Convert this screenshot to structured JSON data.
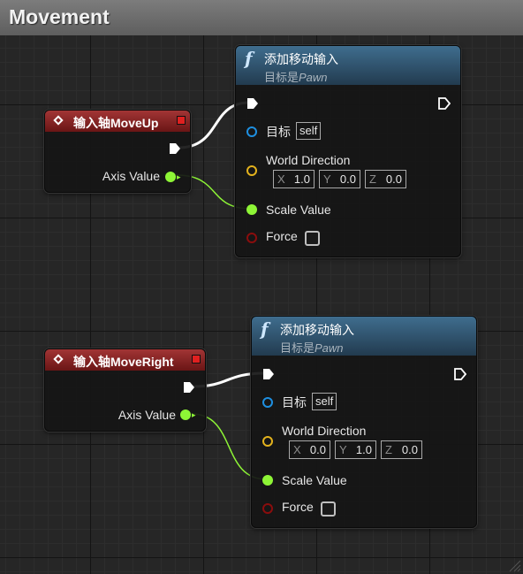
{
  "graph": {
    "title": "Movement"
  },
  "nodes": [
    {
      "event_title": "输入轴MoveUp",
      "axis_value_label": "Axis Value",
      "function": {
        "title": "添加移动输入",
        "subtitle_prefix": "目标是",
        "subtitle_class": "Pawn",
        "target_label": "目标",
        "target_value": "self",
        "world_direction_label": "World Direction",
        "x_axis": "X",
        "x_value": "1.0",
        "y_axis": "Y",
        "y_value": "0.0",
        "z_axis": "Z",
        "z_value": "0.0",
        "scale_value_label": "Scale Value",
        "force_label": "Force",
        "force_checked": false
      }
    },
    {
      "event_title": "输入轴MoveRight",
      "axis_value_label": "Axis Value",
      "function": {
        "title": "添加移动输入",
        "subtitle_prefix": "目标是",
        "subtitle_class": "Pawn",
        "target_label": "目标",
        "target_value": "self",
        "world_direction_label": "World Direction",
        "x_axis": "X",
        "x_value": "0.0",
        "y_axis": "Y",
        "y_value": "1.0",
        "z_axis": "Z",
        "z_value": "0.0",
        "scale_value_label": "Scale Value",
        "force_label": "Force",
        "force_checked": false
      }
    }
  ],
  "colors": {
    "event_header": "#8b2424",
    "function_header": "#2f5672",
    "exec_wire": "#ffffff",
    "float_wire": "#8ef536",
    "object_pin": "#1e8fe0",
    "vector_pin": "#e3b21d",
    "bool_pin": "#8a0d0d"
  }
}
